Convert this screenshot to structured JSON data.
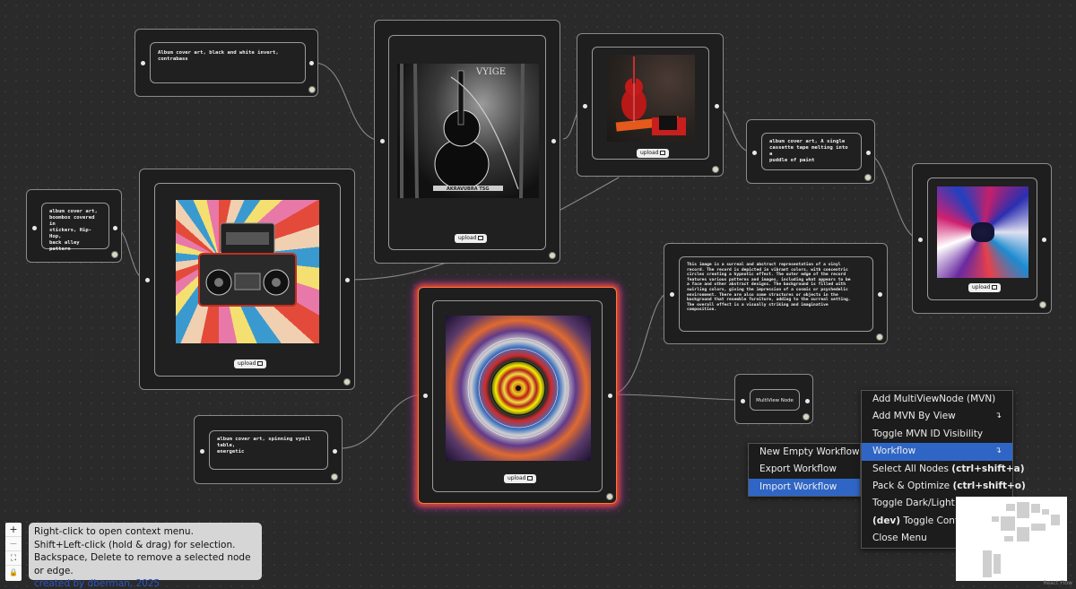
{
  "nodes": {
    "prompt_contrabass": "Album cover art, black and white invert, contrabass",
    "prompt_boombox": "album cover art,\nboombox covered in\nstickers, Hip-Hop,\nback alley pattern",
    "prompt_cassette": "album cover art, A single\ncassette tape melting into a\npuddle of paint",
    "prompt_vinyl_table": "album cover art, spinning vynil table,\nenergetic",
    "description": "This image is a surreal and abstract representation of a vinyl\nrecord. The record is depicted in vibrant colors, with concentric\ncircles creating a hypnotic effect. The outer edge of the record\nfeatures various patterns and images, including what appears to be\na face and other abstract designs. The background is filled with\nswirling colors, giving the impression of a cosmic or psychedelic\nenvironment. There are also some structures or objects in the\nbackground that resemble furniture, adding to the surreal setting.\nThe overall effect is a visually striking and imaginative\ncomposition.",
    "mvn_label": "MultiView Node",
    "upload_label": "upload",
    "contrabass_art_text": "VYIGE",
    "contrabass_art_caption": "AKRAVUBRA TSG"
  },
  "context_menu_main": {
    "items": [
      {
        "label": "Add MultiViewNode (MVN)",
        "arrow": ""
      },
      {
        "label": "Add MVN By View",
        "arrow": "↴"
      },
      {
        "label": "Toggle MVN ID Visibility",
        "arrow": ""
      },
      {
        "label": "Workflow",
        "arrow": "↴"
      },
      {
        "label": "Select All Nodes ",
        "shortcut": "(ctrl+shift+a)",
        "arrow": ""
      },
      {
        "label": "Pack & Optimize ",
        "shortcut": "(ctrl+shift+o)",
        "arrow": ""
      },
      {
        "label": "Toggle Dark/Light Mode",
        "arrow": ""
      },
      {
        "prefix": "(dev)",
        "label": " Toggle Controls Visibility",
        "arrow": ""
      },
      {
        "label": "Close Menu",
        "arrow": ""
      }
    ]
  },
  "context_menu_workflow": {
    "items": [
      {
        "label": "New Empty Workflow"
      },
      {
        "label": "Export Workflow"
      },
      {
        "label": "Import Workflow"
      }
    ]
  },
  "help": {
    "line1": "Right-click to open context menu.",
    "line2": "Shift+Left-click (hold & drag) for selection.",
    "line3": "Backspace, Delete to remove a selected node or edge.",
    "credit": "created by dberman, 2025"
  },
  "controls": {
    "zoom_in": "+",
    "zoom_out": "−",
    "fit": "⛶",
    "lock": "🔒"
  },
  "attribution": "React Flow",
  "colors": {
    "menu_active": "#2f66c6",
    "canvas_bg": "#2a2a2a",
    "node_bg": "#1e1e1e",
    "link": "#2a55c9"
  }
}
